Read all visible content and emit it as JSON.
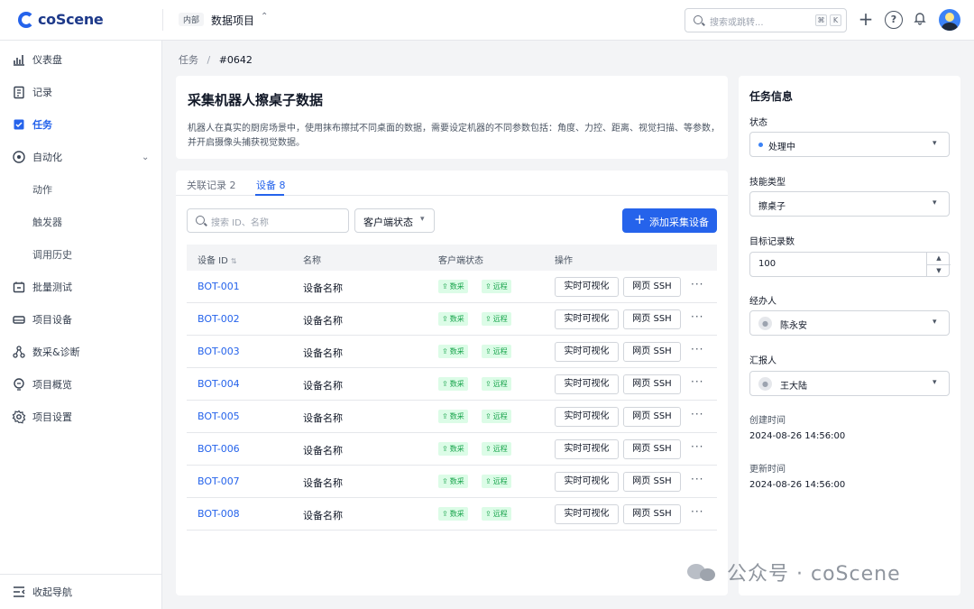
{
  "app": {
    "logo_text": "coScene"
  },
  "topbar": {
    "project_tag": "内部",
    "project_name": "数据项目",
    "search_placeholder": "搜索或跳转...",
    "kbd1": "⌘",
    "kbd2": "K"
  },
  "sidebar": {
    "items": [
      {
        "label": "仪表盘",
        "icon": "bar-chart-icon"
      },
      {
        "label": "记录",
        "icon": "clipboard-icon"
      },
      {
        "label": "任务",
        "icon": "task-icon"
      },
      {
        "label": "自动化",
        "icon": "automation-icon"
      },
      {
        "label": "动作"
      },
      {
        "label": "触发器"
      },
      {
        "label": "调用历史"
      },
      {
        "label": "批量测试",
        "icon": "batch-test-icon"
      },
      {
        "label": "项目设备",
        "icon": "device-icon"
      },
      {
        "label": "数采&诊断",
        "icon": "diagnosis-icon"
      },
      {
        "label": "项目概览",
        "icon": "overview-icon"
      },
      {
        "label": "项目设置",
        "icon": "gear-icon"
      }
    ],
    "collapse_label": "收起导航"
  },
  "breadcrumb": {
    "parent": "任务",
    "separator": "/",
    "current": "#0642"
  },
  "task": {
    "title": "采集机器人擦桌子数据",
    "description": "机器人在真实的厨房场景中，使用抹布擦拭不同桌面的数据，需要设定机器的不同参数包括：角度、力控、距离、视觉扫描、等参数，并开启摄像头捕获视觉数据。"
  },
  "tabs": [
    {
      "label": "关联记录 2"
    },
    {
      "label": "设备 8"
    }
  ],
  "toolbar": {
    "search_placeholder": "搜索 ID、名称",
    "status_filter": "客户端状态",
    "add_label": "添加采集设备"
  },
  "table": {
    "headers": {
      "id": "设备 ID",
      "name": "名称",
      "status": "客户端状态",
      "ops": "操作"
    },
    "badge_collect": "数采",
    "badge_remote": "远程",
    "op_visualize": "实时可视化",
    "op_ssh": "网页 SSH",
    "more": "···",
    "rows": [
      {
        "id": "BOT-001",
        "name": "设备名称"
      },
      {
        "id": "BOT-002",
        "name": "设备名称"
      },
      {
        "id": "BOT-003",
        "name": "设备名称"
      },
      {
        "id": "BOT-004",
        "name": "设备名称"
      },
      {
        "id": "BOT-005",
        "name": "设备名称"
      },
      {
        "id": "BOT-006",
        "name": "设备名称"
      },
      {
        "id": "BOT-007",
        "name": "设备名称"
      },
      {
        "id": "BOT-008",
        "name": "设备名称"
      }
    ]
  },
  "info": {
    "title": "任务信息",
    "status_label": "状态",
    "status_value": "处理中",
    "skill_label": "技能类型",
    "skill_value": "擦桌子",
    "target_label": "目标记录数",
    "target_value": "100",
    "assignee_label": "经办人",
    "assignee_value": "陈永安",
    "reporter_label": "汇报人",
    "reporter_value": "王大陆",
    "created_label": "创建时间",
    "created_value": "2024-08-26 14:56:00",
    "updated_label": "更新时间",
    "updated_value": "2024-08-26 14:56:00"
  },
  "watermark": {
    "text": "公众号 · coScene"
  },
  "colors": {
    "accent": "#2563eb",
    "badge_bg": "#dcfce7",
    "badge_fg": "#16a34a"
  }
}
